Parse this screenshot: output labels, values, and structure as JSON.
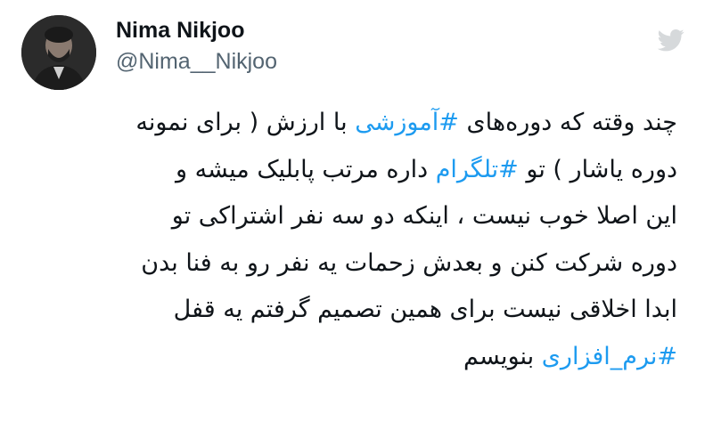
{
  "author": {
    "name": "Nima Nikjoo",
    "handle": "@Nima__Nikjoo",
    "avatar_icon": "user-avatar"
  },
  "brand_icon": "twitter-bird-icon",
  "colors": {
    "hashtag": "#1d9bf0",
    "text": "#0f1419",
    "handle": "#536471"
  },
  "tweet": {
    "lines": [
      {
        "before": "چند وقته که دوره‌های ",
        "hashtag": "#آموزشی",
        "after": " با ارزش ( برای نمونه"
      },
      {
        "before": "دوره یاشار ) تو ",
        "hashtag": "#تلگرام",
        "after": " داره مرتب پابلیک میشه و"
      },
      {
        "before": "این اصلا خوب نیست ، اینکه دو سه نفر اشتراکی تو",
        "hashtag": "",
        "after": ""
      },
      {
        "before": "دوره شرکت کنن و بعدش زحمات یه نفر رو به فنا بدن",
        "hashtag": "",
        "after": ""
      },
      {
        "before": "ابدا اخلاقی نیست برای همین تصمیم گرفتم یه قفل",
        "hashtag": "",
        "after": ""
      },
      {
        "before": "",
        "hashtag": "#نرم_افزاری",
        "after": " بنویسم"
      }
    ]
  }
}
